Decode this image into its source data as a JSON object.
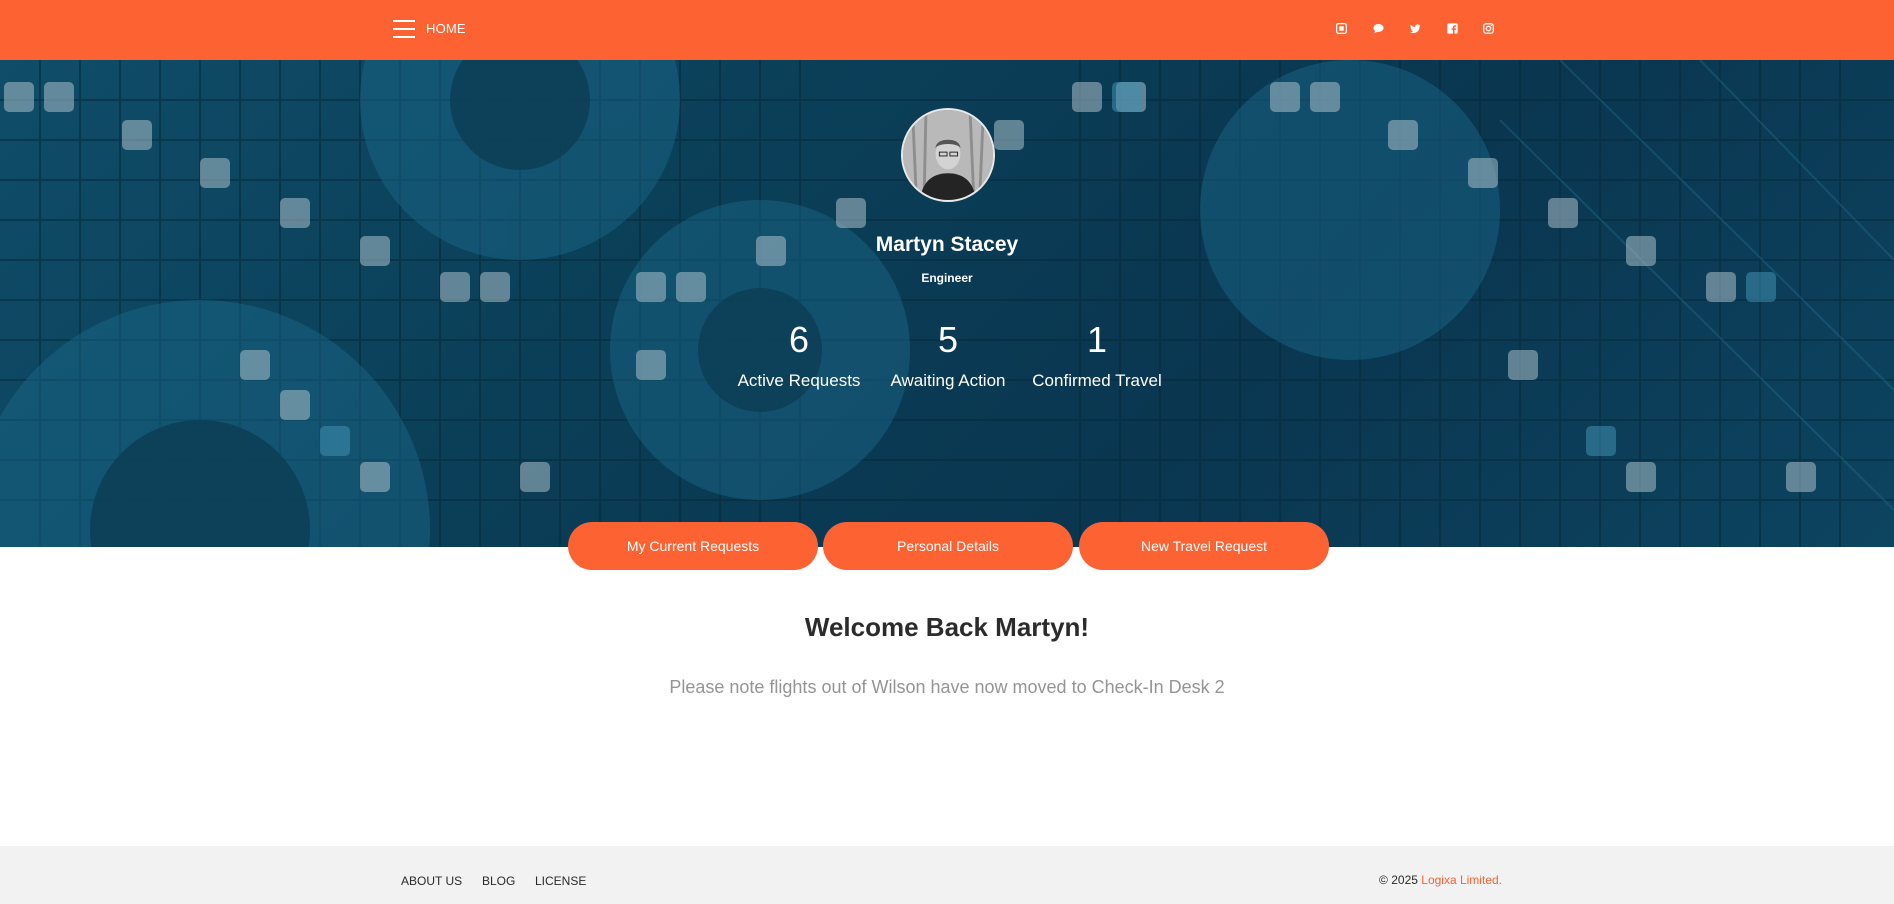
{
  "navbar": {
    "home_label": "HOME",
    "menu_icon": "hamburger-menu-icon",
    "social_icons": [
      "square-icon",
      "chat-icon",
      "twitter-icon",
      "facebook-icon",
      "instagram-icon"
    ]
  },
  "profile": {
    "name": "Martyn Stacey",
    "role": "Engineer"
  },
  "stats": [
    {
      "value": "6",
      "label": "Active Requests"
    },
    {
      "value": "5",
      "label": "Awaiting Action"
    },
    {
      "value": "1",
      "label": "Confirmed Travel"
    }
  ],
  "tabs": [
    {
      "label": "My Current Requests"
    },
    {
      "label": "Personal Details"
    },
    {
      "label": "New Travel Request"
    }
  ],
  "content": {
    "welcome": "Welcome Back Martyn!",
    "notice": "Please note flights out of Wilson have now moved to Check-In Desk 2"
  },
  "footer": {
    "links": [
      "ABOUT US",
      "BLOG",
      "LICENSE"
    ],
    "copyright_prefix": "© 2025 ",
    "brand": "Logixa Limited",
    "suffix": "."
  },
  "colors": {
    "accent": "#fc6232",
    "hero": "#0b3f58"
  }
}
